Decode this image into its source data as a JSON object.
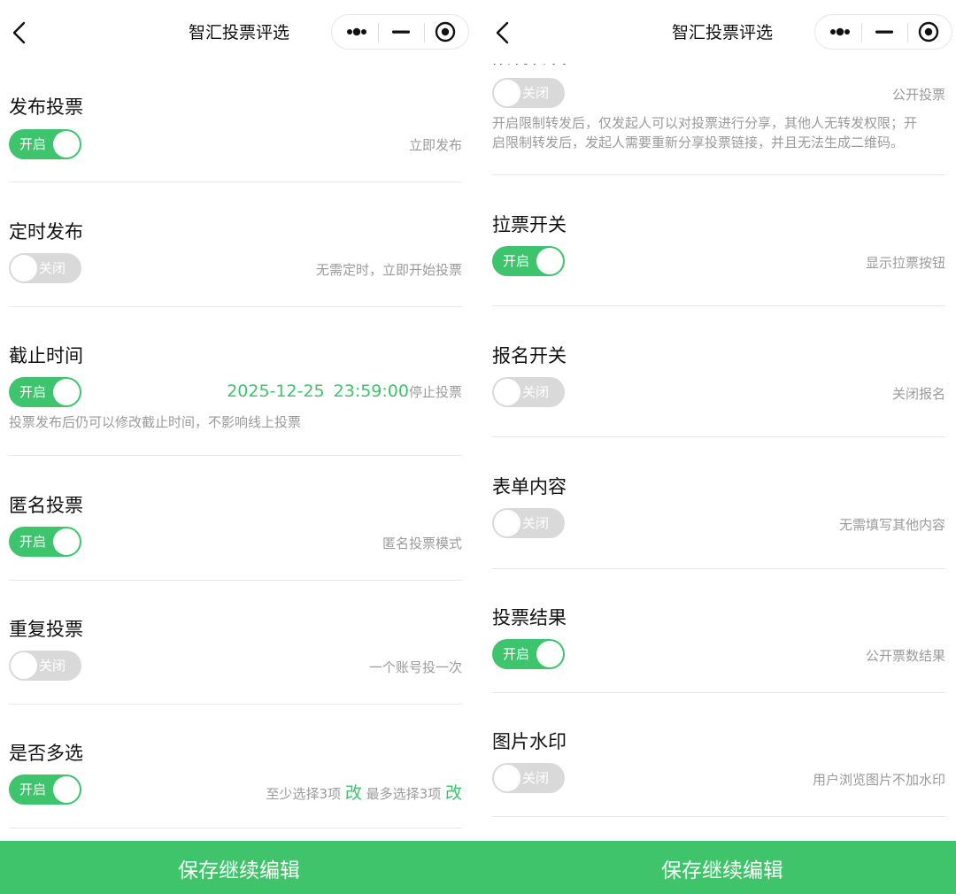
{
  "left": {
    "nav": {
      "title": "智汇投票评选"
    },
    "items": [
      {
        "title": "发布投票",
        "toggle": "开启",
        "right": "立即发布"
      },
      {
        "title": "定时发布",
        "toggle": "关闭",
        "right": "无需定时，立即开始投票"
      },
      {
        "title": "截止时间",
        "toggle": "开启",
        "date": "2025-12-25",
        "time": "23:59:00",
        "right": "停止投票",
        "desc": "投票发布后仍可以修改截止时间，不影响线上投票"
      },
      {
        "title": "匿名投票",
        "toggle": "开启",
        "right": "匿名投票模式"
      },
      {
        "title": "重复投票",
        "toggle": "关闭",
        "right": "一个账号投一次"
      },
      {
        "title": "是否多选",
        "toggle": "开启",
        "min_text": "至少选择3项",
        "min_edit": "改",
        "max_text": "最多选择3项",
        "max_edit": "改"
      }
    ],
    "save_button": "保存继续编辑"
  },
  "right": {
    "nav": {
      "title": "智汇投票评选"
    },
    "partial_title": "限制转发",
    "items": [
      {
        "title": "限制转发",
        "toggle": "关闭",
        "right": "公开投票",
        "desc1": "开启限制转发后，仅发起人可以对投票进行分享，其他人无转发权限；开",
        "desc2": "启限制转发后，发起人需要重新分享投票链接，并且无法生成二维码。"
      },
      {
        "title": "拉票开关",
        "toggle": "开启",
        "right": "显示拉票按钮"
      },
      {
        "title": "报名开关",
        "toggle": "关闭",
        "right": "关闭报名"
      },
      {
        "title": "表单内容",
        "toggle": "关闭",
        "right": "无需填写其他内容"
      },
      {
        "title": "投票结果",
        "toggle": "开启",
        "right": "公开票数结果"
      },
      {
        "title": "图片水印",
        "toggle": "关闭",
        "right": "用户浏览图片不加水印"
      }
    ],
    "save_button": "保存继续编辑"
  },
  "colors": {
    "accent": "#3dc46c",
    "toggle_off": "#d9d9d9",
    "muted_text": "#9a9a9a"
  },
  "icons": [
    "back-arrow-icon",
    "more-dots-icon",
    "minimize-icon",
    "close-circle-icon"
  ]
}
